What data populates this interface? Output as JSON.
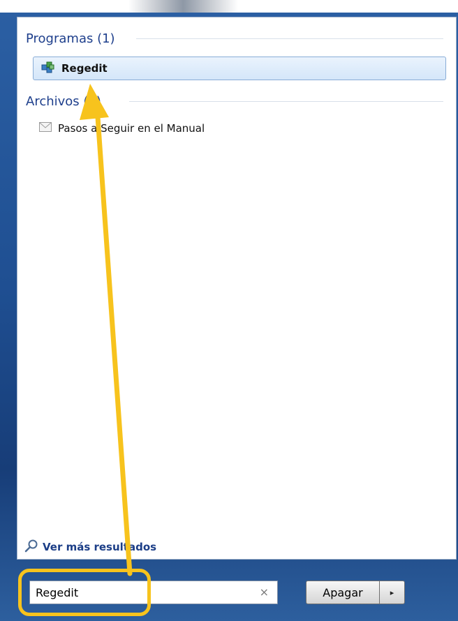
{
  "groups": {
    "programs": {
      "header": "Programas (1)"
    },
    "files": {
      "header": "Archivos (1)"
    }
  },
  "results": {
    "regedit": {
      "label": "Regedit",
      "icon": "regedit-icon"
    },
    "manual": {
      "label": "Pasos a Seguir en el Manual",
      "icon": "document-icon"
    }
  },
  "more": {
    "label": "Ver más resultados",
    "icon": "search-icon"
  },
  "search": {
    "value": "Regedit",
    "clear_glyph": "×"
  },
  "power": {
    "label": "Apagar",
    "arrow": "▸"
  },
  "colors": {
    "frame": "#1f4f92",
    "header_text": "#1e3f8c",
    "selection": "#d4e6f9",
    "annotation": "#f7c31d"
  }
}
